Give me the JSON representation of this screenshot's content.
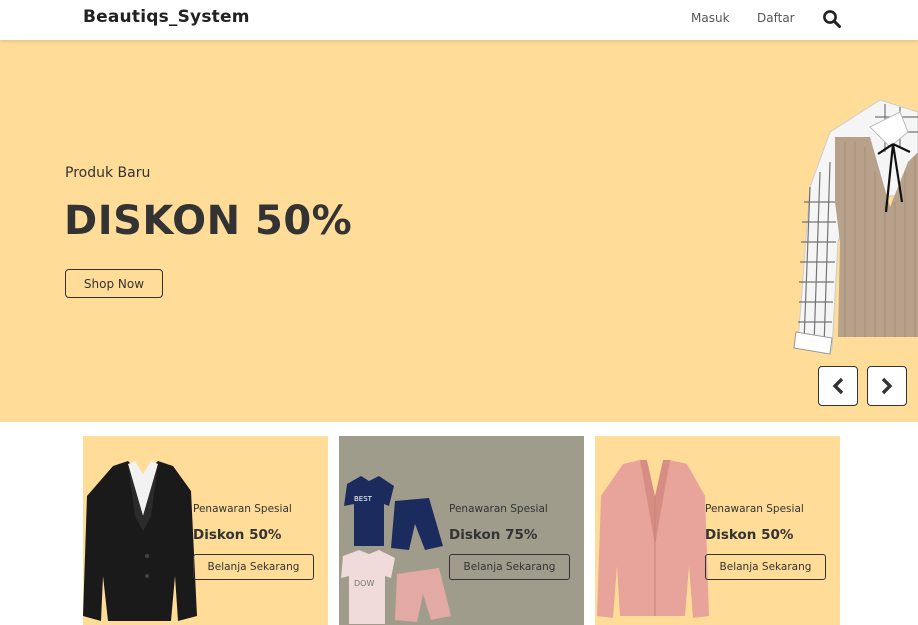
{
  "navbar": {
    "brand": "Beautiqs_System",
    "links": [
      "Masuk",
      "Daftar"
    ],
    "search_icon": "search-icon"
  },
  "hero": {
    "subtitle": "Produk Baru",
    "title": "DISKON 50%",
    "button_label": "Shop Now",
    "background": "#ffdd99",
    "image": "checkered-shirt-with-knit-vest",
    "prev_icon": "chevron-left-icon",
    "next_icon": "chevron-right-icon"
  },
  "cards": [
    {
      "tag": "Penawaran Spesial",
      "discount": "Diskon 50%",
      "button_label": "Belanja Sekarang",
      "background": "#ffdd99",
      "image": "black-suit-jacket"
    },
    {
      "tag": "Penawaran Spesial",
      "discount": "Diskon 75%",
      "button_label": "Belanja Sekarang",
      "background": "#a09c8c",
      "image": "kids-clothing-sets"
    },
    {
      "tag": "Penawaran Spesial",
      "discount": "Diskon 50%",
      "button_label": "Belanja Sekarang",
      "background": "#ffdd99",
      "image": "pink-blazer"
    }
  ]
}
